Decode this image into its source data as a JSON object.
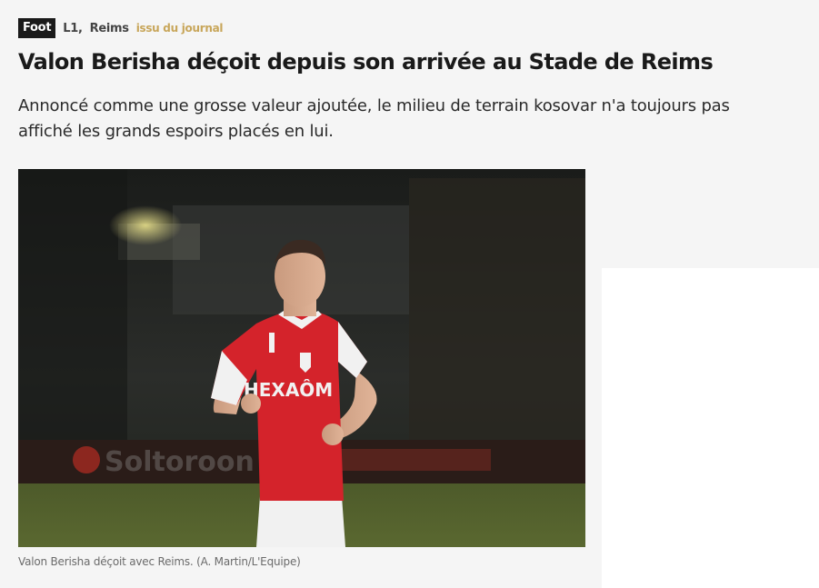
{
  "tags": {
    "sport": "Foot",
    "league": "L1,",
    "club": "Reims",
    "source": "issu du journal"
  },
  "article": {
    "title": "Valon Berisha déçoit depuis son arrivée au Stade de Reims",
    "lead": "Annoncé comme une grosse valeur ajoutée, le milieu de terrain kosovar n'a toujours pas affiché les grands espoirs placés en lui.",
    "caption": "Valon Berisha déçoit avec Reims. (A. Martin/L'Equipe)"
  },
  "photo": {
    "jersey_sponsor": "HEXAÔM",
    "ad_board_text": "Soltoroon"
  },
  "colors": {
    "tag_bg": "#1a1a1a",
    "source_gold": "#c8a65a",
    "jersey_red": "#d4232b"
  }
}
